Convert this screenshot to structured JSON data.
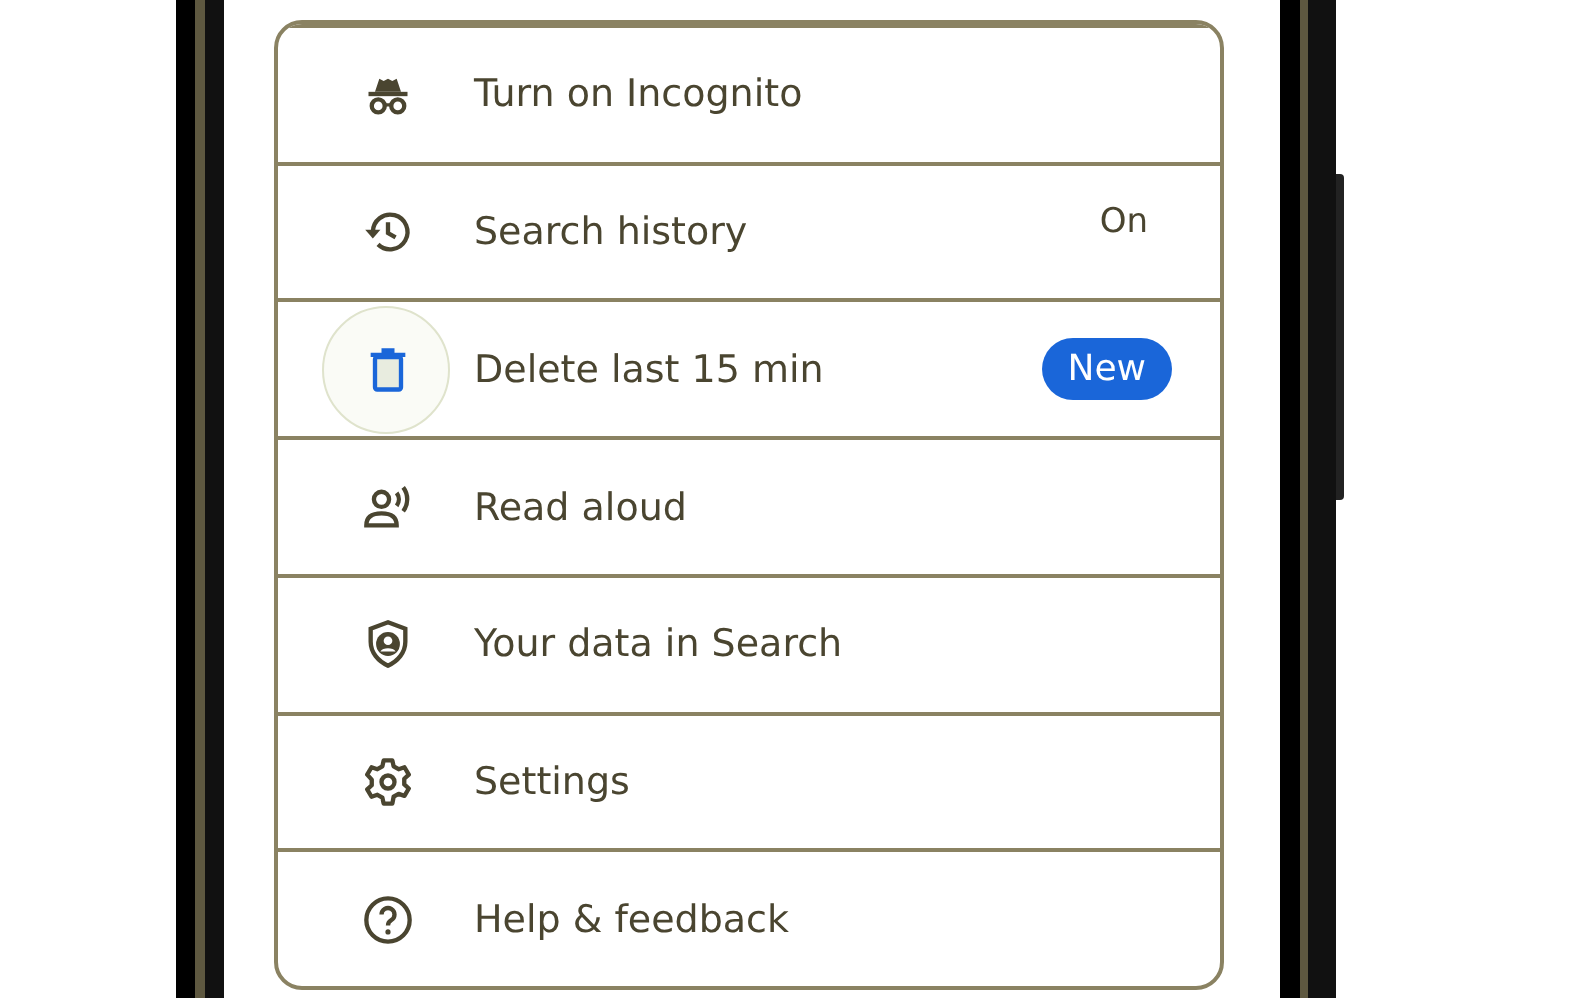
{
  "menu": {
    "items": [
      {
        "kind": "incognito",
        "label": "Turn on Incognito",
        "pressed": false
      },
      {
        "kind": "history",
        "label": "Search history",
        "status": "On",
        "pressed": false
      },
      {
        "kind": "delete",
        "label": "Delete last 15 min",
        "badge": "New",
        "pressed": true
      },
      {
        "kind": "read-aloud",
        "label": "Read aloud",
        "pressed": false
      },
      {
        "kind": "data",
        "label": "Your data in Search",
        "pressed": false
      },
      {
        "kind": "settings",
        "label": "Settings",
        "pressed": false
      },
      {
        "kind": "help",
        "label": "Help & feedback",
        "pressed": false
      }
    ]
  }
}
